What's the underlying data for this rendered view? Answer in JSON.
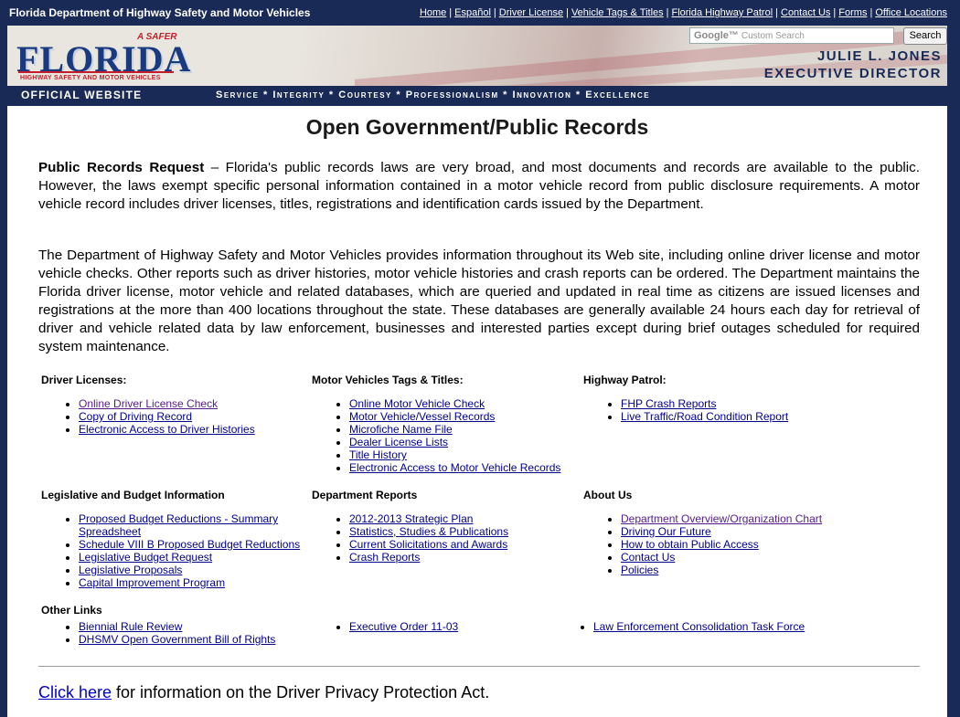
{
  "topbar": {
    "site_title": "Florida Department of Highway Safety and Motor Vehicles",
    "nav": [
      {
        "label": "Home"
      },
      {
        "label": "Español"
      },
      {
        "label": "Driver License"
      },
      {
        "label": "Vehicle Tags & Titles"
      },
      {
        "label": "Florida Highway Patrol"
      },
      {
        "label": "Contact Us"
      },
      {
        "label": "Forms"
      },
      {
        "label": "Office Locations"
      }
    ]
  },
  "header": {
    "logo": {
      "safer": "A SAFER",
      "florida": "FLORIDA",
      "tagline": "HIGHWAY SAFETY AND MOTOR VEHICLES"
    },
    "search": {
      "placeholder": "Custom Search",
      "google": "Google™",
      "button": "Search"
    },
    "executive_name": "JULIE L. JONES",
    "executive_title": "EXECUTIVE DIRECTOR",
    "official": "OFFICIAL WEBSITE",
    "values": "Service * Integrity * Courtesy * Professionalism * Innovation * Excellence"
  },
  "main": {
    "title": "Open Government/Public Records",
    "para1_lead": "Public Records Request",
    "para1_body": " – Florida's public records laws are very broad, and most documents and records are available to the public. However, the laws exempt specific personal information contained in a motor vehicle record from public disclosure requirements. A motor vehicle record includes driver licenses, titles, registrations and identification cards issued by the Department.",
    "para2": "The Department of Highway Safety and Motor Vehicles provides information throughout its Web site, including online driver license and motor vehicle checks. Other reports such as driver histories, motor vehicle histories and crash reports can be ordered. The Department maintains the Florida driver license, motor vehicle and related databases, which are queried and updated in real time as citizens are issued licenses and registrations at the more than 400 locations throughout the state. These databases are generally available 24 hours each day for retrieval of driver and vehicle related data by law enforcement, businesses and interested parties except during brief outages scheduled for required system maintenance.",
    "sections": {
      "driver_licenses": {
        "heading": "Driver Licenses:",
        "links": [
          "Online Driver License Check",
          "Copy of Driving Record",
          "Electronic Access to Driver Histories"
        ]
      },
      "motor_vehicles": {
        "heading": "Motor Vehicles Tags & Titles:",
        "links": [
          "Online Motor Vehicle Check",
          "Motor Vehicle/Vessel Records",
          "Microfiche Name File",
          "Dealer License Lists",
          "Title History",
          "Electronic Access to Motor Vehicle Records"
        ]
      },
      "highway_patrol": {
        "heading": "Highway Patrol:",
        "links": [
          "FHP Crash Reports",
          "Live Traffic/Road Condition Report"
        ]
      },
      "legislative": {
        "heading": "Legislative and Budget Information",
        "links": [
          "Proposed Budget Reductions - Summary Spreadsheet",
          "Schedule VIII B Proposed Budget Reductions",
          "Legislative Budget Request",
          "Legislative Proposals",
          "Capital Improvement Program"
        ]
      },
      "department_reports": {
        "heading": "Department Reports",
        "links": [
          "2012-2013 Strategic Plan",
          "Statistics, Studies & Publications",
          "Current Solicitations and Awards",
          "Crash Reports"
        ]
      },
      "about_us": {
        "heading": "About Us",
        "links": [
          "Department Overview/Organization Chart",
          "Driving Our Future",
          "How to obtain Public Access",
          "Contact Us",
          "Policies"
        ]
      },
      "other_links": {
        "heading": "Other Links",
        "col1": [
          "Biennial Rule Review",
          "DHSMV Open Government Bill of Rights"
        ],
        "col2": [
          "Executive Order 11-03"
        ],
        "col3": [
          "Law Enforcement Consolidation Task Force"
        ]
      }
    },
    "privacy": {
      "link": "Click here",
      "text": " for information on the Driver Privacy Protection Act."
    }
  },
  "colors": {
    "navy": "#1a2a56",
    "link": "#00008b",
    "visited": "#551a8b",
    "logo_red": "#c41e2b",
    "logo_blue": "#1a3a80"
  }
}
